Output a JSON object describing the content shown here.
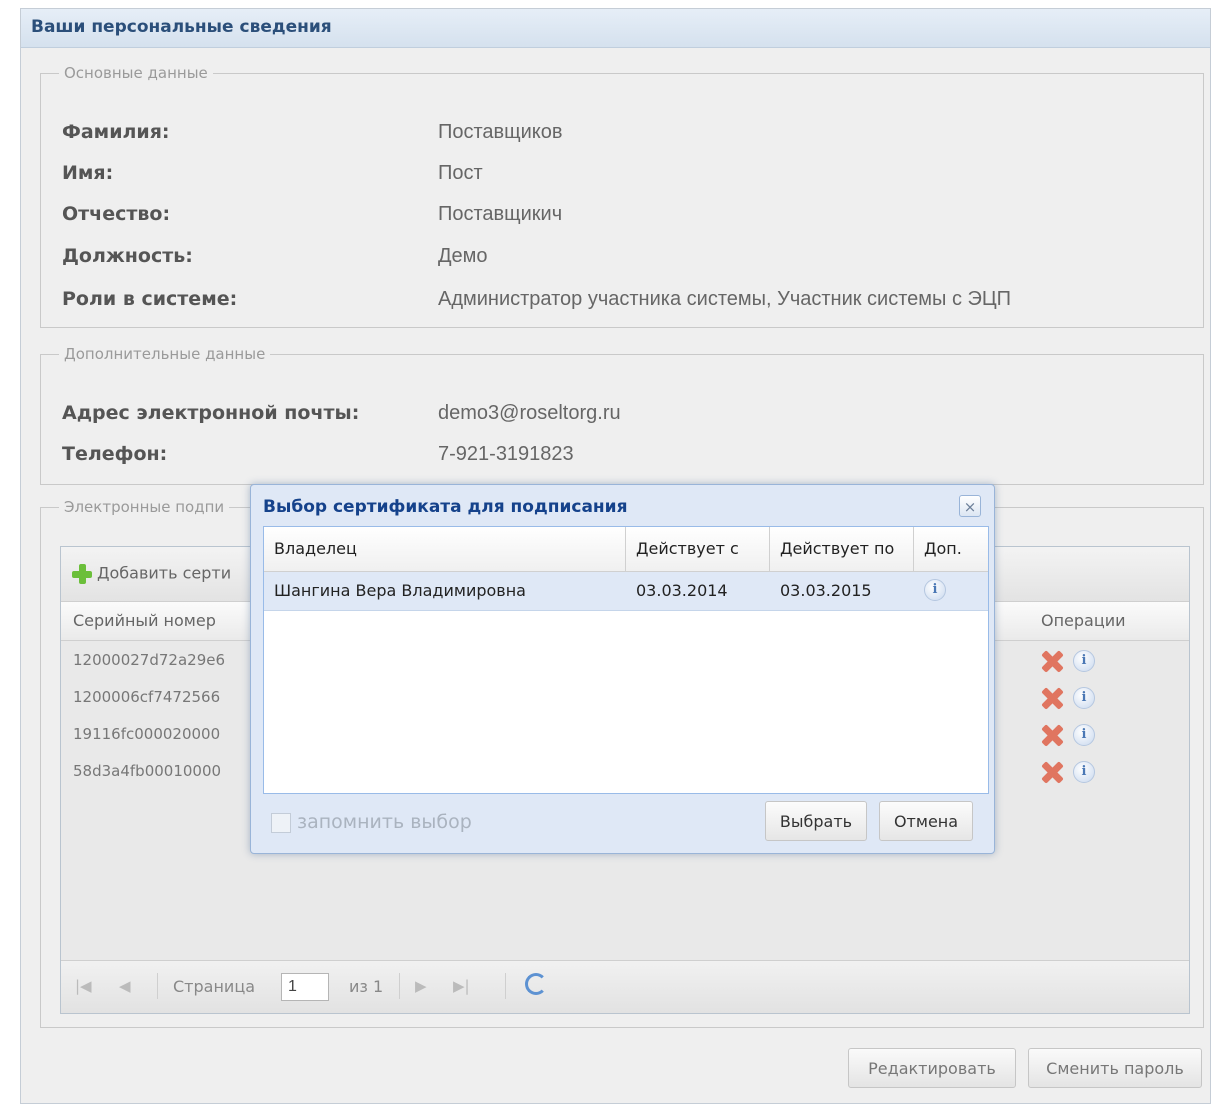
{
  "panel": {
    "title": "Ваши персональные сведения"
  },
  "basic": {
    "legend": "Основные данные",
    "fields": [
      {
        "label": "Фамилия:",
        "value": "Поставщиков"
      },
      {
        "label": "Имя:",
        "value": "Пост"
      },
      {
        "label": "Отчество:",
        "value": "Поставщикич"
      },
      {
        "label": "Должность:",
        "value": "Демо"
      },
      {
        "label": "Роли в системе:",
        "value": "Администратор участника системы, Участник системы с ЭЦП"
      }
    ]
  },
  "extra": {
    "legend": "Дополнительные данные",
    "fields": [
      {
        "label": "Адрес электронной почты:",
        "value": "demo3@roseltorg.ru"
      },
      {
        "label": "Телефон:",
        "value": "7-921-3191823"
      }
    ]
  },
  "signatures": {
    "legend": "Электронные подпи",
    "add_label": "Добавить серти",
    "col_serial": "Серийный номер",
    "col_ops": "Операции",
    "rows": [
      {
        "serial": "12000027d72a29e6"
      },
      {
        "serial": "1200006cf7472566"
      },
      {
        "serial": "19116fc000020000"
      },
      {
        "serial": "58d3a4fb00010000"
      }
    ],
    "pager": {
      "page_label": "Страница",
      "page_value": "1",
      "of_label": "из 1"
    }
  },
  "buttons": {
    "edit": "Редактировать",
    "change_password": "Сменить пароль"
  },
  "modal": {
    "title": "Выбор сертификата для подписания",
    "close": "×",
    "columns": [
      "Владелец",
      "Действует с",
      "Действует по",
      "Доп."
    ],
    "rows": [
      {
        "owner": "Шангина Вера Владимировна",
        "from": "03.03.2014",
        "to": "03.03.2015"
      }
    ],
    "remember_label": "запомнить выбор",
    "select_label": "Выбрать",
    "cancel_label": "Отмена"
  },
  "icons": {
    "add": "plus-icon",
    "delete": "delete-icon",
    "info": "info-icon",
    "refresh": "refresh-icon",
    "close": "close-icon"
  },
  "colors": {
    "accent": "#15428b",
    "selection": "#dfe8f6",
    "add": "#6bbf3a",
    "delete": "#e07560"
  }
}
